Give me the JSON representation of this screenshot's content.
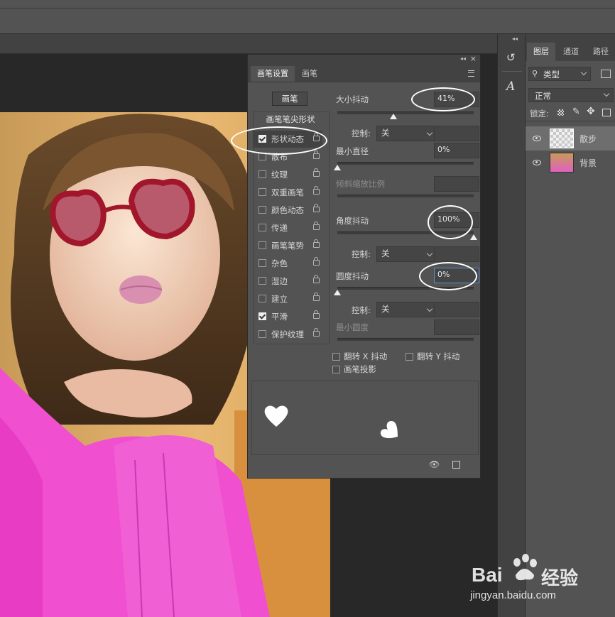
{
  "brush_panel": {
    "tabs": [
      "画笔设置",
      "画笔"
    ],
    "preset_button": "画笔",
    "tip_shape": "画笔笔尖形状",
    "options": [
      {
        "label": "形状动态",
        "checked": true
      },
      {
        "label": "散布",
        "checked": false
      },
      {
        "label": "纹理",
        "checked": false
      },
      {
        "label": "双重画笔",
        "checked": false
      },
      {
        "label": "颜色动态",
        "checked": false
      },
      {
        "label": "传递",
        "checked": false
      },
      {
        "label": "画笔笔势",
        "checked": false
      },
      {
        "label": "杂色",
        "checked": false
      },
      {
        "label": "湿边",
        "checked": false
      },
      {
        "label": "建立",
        "checked": false
      },
      {
        "label": "平滑",
        "checked": true
      },
      {
        "label": "保护纹理",
        "checked": false
      }
    ],
    "size_jitter": {
      "label": "大小抖动",
      "value": "41%",
      "level": 0.41
    },
    "control1": {
      "label": "控制:",
      "value": "关"
    },
    "min_diameter": {
      "label": "最小直径",
      "value": "0%",
      "level": 0
    },
    "tilt_scale": {
      "label": "倾斜缩放比例"
    },
    "angle_jitter": {
      "label": "角度抖动",
      "value": "100%",
      "level": 1
    },
    "control2": {
      "label": "控制:",
      "value": "关"
    },
    "roundness_jitter": {
      "label": "圆度抖动",
      "value": "0%",
      "level": 0
    },
    "control3": {
      "label": "控制:",
      "value": "关"
    },
    "min_roundness": {
      "label": "最小圆度"
    },
    "flip_x": "翻转 X 抖动",
    "flip_y": "翻转 Y 抖动",
    "brush_projection": "画笔投影"
  },
  "layers_panel": {
    "tabs": [
      "图层",
      "通道",
      "路径"
    ],
    "filter_label": "类型",
    "blend_mode": "正常",
    "lock_label": "锁定:",
    "layers": [
      {
        "name": "散步",
        "visible": true
      },
      {
        "name": "背景",
        "visible": true
      }
    ]
  },
  "watermark": {
    "brand": "Bai",
    "brand2": "经验",
    "url": "jingyan.baidu.com"
  }
}
